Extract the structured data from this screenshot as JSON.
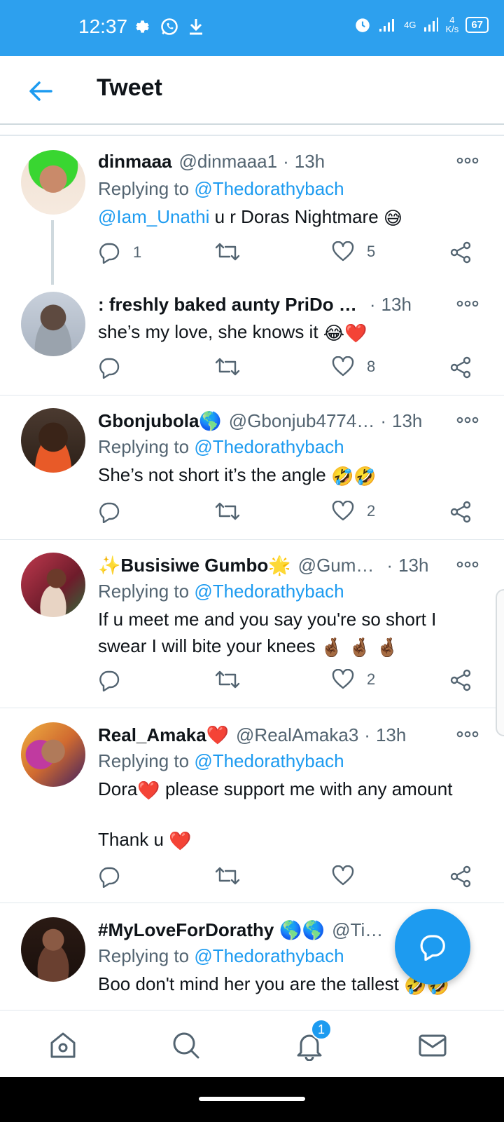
{
  "status_bar": {
    "time": "12:37",
    "net_speed_value": "4",
    "net_speed_unit": "K/s",
    "network_type": "4G",
    "battery": "67"
  },
  "header": {
    "title": "Tweet"
  },
  "reply_label": "Replying to",
  "tweets": [
    {
      "name": "dinmaaa",
      "handle": "@dinmaaa1",
      "time": "13h",
      "replying_to": "@Thedorathybach",
      "mention": "@Iam_Unathi",
      "text": "u r Doras Nightmare",
      "emoji": "😅",
      "replies": "1",
      "retweets": "",
      "likes": "5"
    },
    {
      "name": ": freshly baked aunty PriDo …",
      "handle": "",
      "time": "13h",
      "text": "she’s my love, she knows it",
      "emoji": "😂❤️",
      "replies": "",
      "retweets": "",
      "likes": "8"
    },
    {
      "name": "Gbonjubola🌎",
      "handle": "@Gbonjub4774…",
      "time": "13h",
      "replying_to": "@Thedorathybach",
      "text": "She’s not short it’s the angle",
      "emoji": "🤣🤣",
      "replies": "",
      "retweets": "",
      "likes": "2"
    },
    {
      "name": "✨Busisiwe Gumbo🌟",
      "handle": "@Gum…",
      "time": "13h",
      "replying_to": "@Thedorathybach",
      "text_line1": "If u meet me and you say you're so short I",
      "text_line2": "swear I will bite your knees",
      "emoji": "🤞🏾 🤞🏾 🤞🏾",
      "replies": "",
      "retweets": "",
      "likes": "2"
    },
    {
      "name": "Real_Amaka❤️",
      "handle": "@RealAmaka3",
      "time": "13h",
      "replying_to": "@Thedorathybach",
      "text_a1": "Dora",
      "emoji_a": "❤️",
      "text_a2": "please support me with any amount",
      "text_b": "Thank u",
      "emoji_b": "❤️",
      "replies": "",
      "retweets": "",
      "likes": ""
    },
    {
      "name": "#MyLoveForDorathy",
      "name_emoji": "🌎🌎",
      "handle": "@Ti…",
      "time": "13h",
      "replying_to": "@Thedorathybach",
      "text": "Boo don't mind her you are the tallest",
      "emoji": "🤣🤣"
    }
  ],
  "bottom_nav": {
    "notification_badge": "1"
  },
  "colors": {
    "status_bar": "#2da0ee",
    "accent": "#1d9bf0",
    "secondary_text": "#536471",
    "heart_red": "#e0245e"
  }
}
